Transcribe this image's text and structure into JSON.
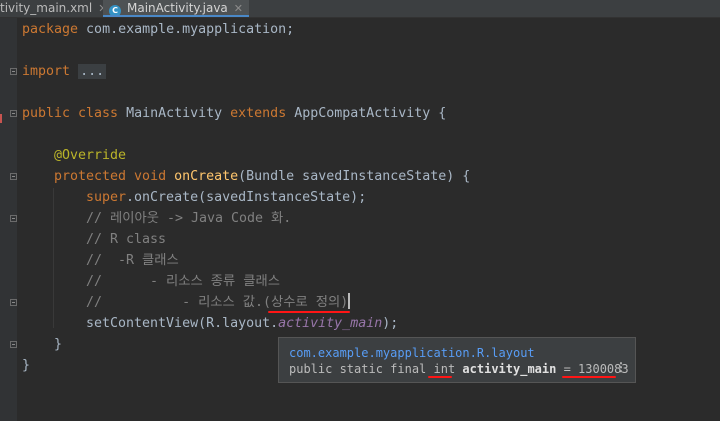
{
  "tabs": [
    {
      "label": "tivity_main.xml",
      "active": false
    },
    {
      "label": "MainActivity.java",
      "active": true
    }
  ],
  "code": {
    "l1_kw": "package",
    "l1_rest": " com.example.myapplication;",
    "l2_kw": "import",
    "l2_fold": "...",
    "l3_kw1": "public class",
    "l3_mid": " MainActivity ",
    "l3_kw2": "extends",
    "l3_rest": " AppCompatActivity {",
    "l4_ann": "@Override",
    "l5_kw": "protected void",
    "l5_fn": "onCreate",
    "l5_rest": "(Bundle savedInstanceState) {",
    "l6_kw": "super",
    "l6_rest": ".onCreate(savedInstanceState);",
    "l7": "// 레이아웃 -> Java Code 화.",
    "l8": "// R class",
    "l9": "//  -R 클래스",
    "l10": "//      - 리소스 종류 클래스",
    "l11": "//          - 리소스 값.(상수로 정의)",
    "l12_a": "setContentView(R.layout.",
    "l12_b": "activity_main",
    "l12_c": ");",
    "l13": "}",
    "l14": "}"
  },
  "tooltip": {
    "line1": "com.example.myapplication.R.layout",
    "line2_a": "public static final ",
    "line2_int": "int",
    "line2_b": " ",
    "line2_name": "activity_main",
    "line2_c": " = ",
    "line2_value": "1300083",
    "more": "⋮"
  },
  "colors": {
    "keyword": "#cc7832",
    "method": "#ffc66d",
    "annotation": "#bbb529",
    "comment": "#808080",
    "field": "#9876aa",
    "underline": "#ff1515"
  }
}
